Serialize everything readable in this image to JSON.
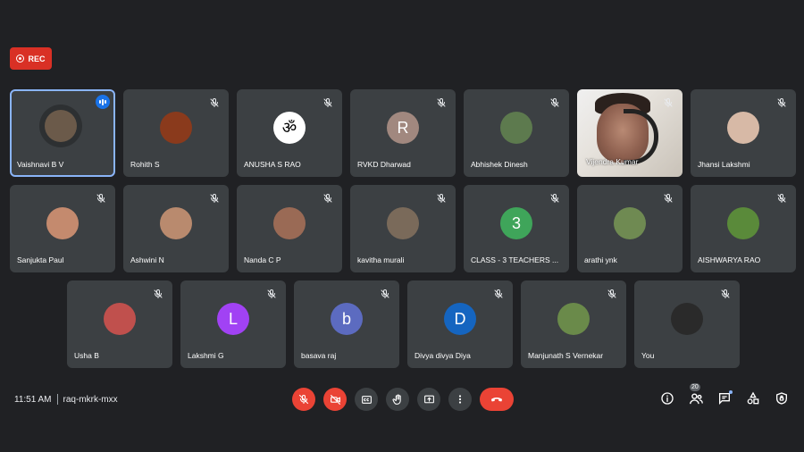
{
  "recording": {
    "label": "REC"
  },
  "meeting": {
    "time": "11:51 AM",
    "code": "raq-mkrk-mxx"
  },
  "participants_count": "20",
  "participants": [
    {
      "name": "Vaishnavi B V",
      "avatar_color": "#6b5a4a",
      "avatar_letter": "",
      "active": true
    },
    {
      "name": "Rohith S",
      "avatar_color": "#8a3a1c",
      "avatar_letter": ""
    },
    {
      "name": "ANUSHA S RAO",
      "avatar_color": "#ffffff",
      "avatar_letter": "ॐ"
    },
    {
      "name": "RVKD Dharwad",
      "avatar_color": "#a1887f",
      "avatar_letter": "R"
    },
    {
      "name": "Abhishek Dinesh",
      "avatar_color": "#5d7a4e",
      "avatar_letter": ""
    },
    {
      "name": "Vijendra Kumar",
      "video": true
    },
    {
      "name": "Jhansi Lakshmi",
      "avatar_color": "#d7b9a6",
      "avatar_letter": ""
    },
    {
      "name": "Sanjukta Paul",
      "avatar_color": "#c48a6e",
      "avatar_letter": ""
    },
    {
      "name": "Ashwini N",
      "avatar_color": "#b98a6e",
      "avatar_letter": ""
    },
    {
      "name": "Nanda C P",
      "avatar_color": "#9a6a55",
      "avatar_letter": ""
    },
    {
      "name": "kavitha murali",
      "avatar_color": "#7a6a5a",
      "avatar_letter": ""
    },
    {
      "name": "CLASS - 3 TEACHERS ...",
      "avatar_color": "#3fa55a",
      "avatar_letter": "3"
    },
    {
      "name": "arathi ynk",
      "avatar_color": "#6f8a52",
      "avatar_letter": ""
    },
    {
      "name": "AISHWARYA RAO",
      "avatar_color": "#5a8a3a",
      "avatar_letter": ""
    },
    {
      "name": "Usha B",
      "avatar_color": "#c0504d",
      "avatar_letter": ""
    },
    {
      "name": "Lakshmi G",
      "avatar_color": "#a142f4",
      "avatar_letter": "L"
    },
    {
      "name": "basava raj",
      "avatar_color": "#5c6bc0",
      "avatar_letter": "b"
    },
    {
      "name": "Divya divya Diya",
      "avatar_color": "#1565c0",
      "avatar_letter": "D"
    },
    {
      "name": "Manjunath S Vernekar",
      "avatar_color": "#6a8a4a",
      "avatar_letter": ""
    },
    {
      "name": "You",
      "avatar_color": "#2a2a2a",
      "avatar_letter": ""
    }
  ],
  "colors": {
    "background": "#202124",
    "tile": "#3c4043",
    "danger": "#ea4335",
    "accent": "#8ab4f8"
  },
  "toolbar": {
    "buttons": [
      "mic-off-icon",
      "camera-off-icon",
      "captions-icon",
      "raise-hand-icon",
      "present-icon",
      "more-options-icon",
      "end-call-icon"
    ]
  },
  "right_icons": [
    "info-icon",
    "people-icon",
    "chat-icon",
    "activities-icon",
    "host-controls-icon"
  ]
}
